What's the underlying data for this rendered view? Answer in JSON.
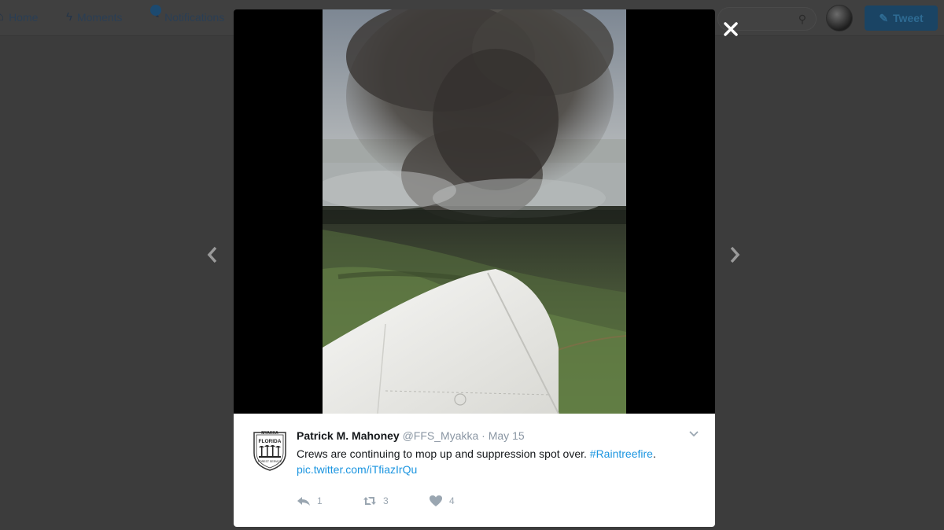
{
  "topbar": {
    "nav": [
      {
        "label": "Home",
        "icon": "home-icon"
      },
      {
        "label": "Moments",
        "icon": "lightning-icon"
      },
      {
        "label": "Notifications",
        "icon": "bell-icon"
      }
    ],
    "tweet_button": "Tweet"
  },
  "lightbox": {
    "prev_icon": "chevron-left-icon",
    "next_icon": "chevron-right-icon",
    "close_icon": "close-icon"
  },
  "tweet": {
    "name": "Patrick M. Mahoney",
    "handle": "@FFS_Myakka",
    "separator": "·",
    "date": "May 15",
    "text": "Crews are continuing to mop up and suppression spot over.",
    "hashtag": "#Raintreefire",
    "trailing": ".",
    "pic_link": "pic.twitter.com/iTfiazIrQu",
    "avatar_text": {
      "top": "MYAKKA",
      "middle": "FLORIDA",
      "bottom": "FOREST SERVICE"
    },
    "actions": {
      "reply": "1",
      "retweet": "3",
      "like": "4"
    }
  },
  "colors": {
    "link": "#1b95e0",
    "overlay": "#3c3c3c"
  }
}
